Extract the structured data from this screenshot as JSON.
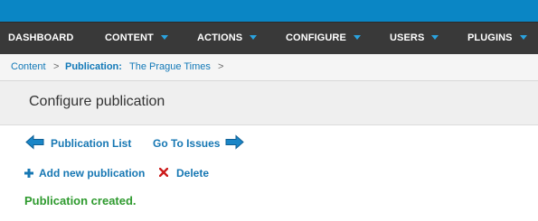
{
  "nav": {
    "items": [
      {
        "label": "DASHBOARD",
        "has_menu": false
      },
      {
        "label": "CONTENT",
        "has_menu": true
      },
      {
        "label": "ACTIONS",
        "has_menu": true
      },
      {
        "label": "CONFIGURE",
        "has_menu": true
      },
      {
        "label": "USERS",
        "has_menu": true
      },
      {
        "label": "PLUGINS",
        "has_menu": true
      }
    ],
    "top_bar_color": "#0a86c5",
    "bar_color": "#393939",
    "caret_color": "#2aa3e0"
  },
  "breadcrumb": {
    "root": "Content",
    "separator": ">",
    "section_label": "Publication:",
    "section_value": "The Prague Times"
  },
  "page": {
    "title": "Configure publication"
  },
  "actions": {
    "publication_list": "Publication List",
    "go_to_issues": "Go To Issues",
    "add_new_publication": "Add new publication",
    "delete": "Delete"
  },
  "icons": {
    "back": "arrow-left-icon",
    "forward": "arrow-right-icon",
    "add": "plus-icon",
    "delete": "cross-icon"
  },
  "message": {
    "text": "Publication created.",
    "color": "#2e9a2e"
  }
}
